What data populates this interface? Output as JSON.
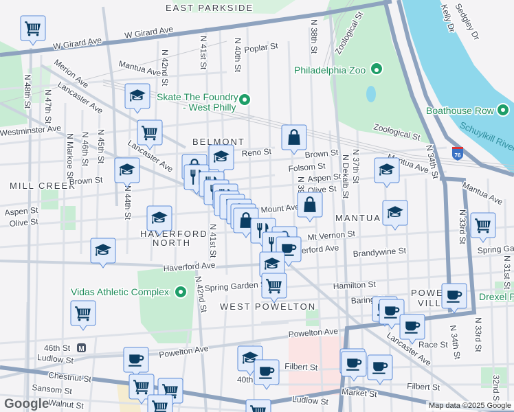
{
  "map": {
    "attribution": "Map data ©2025 Google",
    "logo": "Google",
    "colors": {
      "marker_fill": "#e3ecfb",
      "marker_border": "#5b8bd8",
      "marker_icon": "#0b3d62",
      "park": "#c8ecd4",
      "water": "#8fd8ec",
      "major_road": "#8ea3bf",
      "poi": "#1e8a5a"
    },
    "neighborhoods": [
      "EAST PARKSIDE",
      "BELMONT",
      "MILL CREEK",
      "HAVERFORD",
      "NORTH",
      "MANTUA",
      "WEST POWELTON",
      "POWEL",
      "VILLA"
    ],
    "pois": [
      "Philadelphia Zoo",
      "Skate The Foundry",
      "- West Philly",
      "Boathouse Row",
      "Vidas Athletic Complex",
      "Drexel P"
    ],
    "water": [
      "Schuylkill River"
    ],
    "highway_shield": "76",
    "streets": [
      "W Girard Ave",
      "W Girard Ave",
      "Mantua Ave",
      "Merion Ave",
      "Lancaster Ave",
      "Lancaster Ave",
      "N 48th St",
      "N 47th St",
      "N 42nd St",
      "N 41st St",
      "N 40th St",
      "N 38th St",
      "Poplar St",
      "Zoological St",
      "Zoological St",
      "Westminster Ave",
      "N Markoe St",
      "N 46th St",
      "N 45th St",
      "Reno St",
      "Brown St",
      "Brown St",
      "Folsom St",
      "Aspen St",
      "Olive St",
      "N 37th St",
      "N Dekalb St",
      "Mantua Ave",
      "Mantua Ave",
      "N 34th St",
      "N 44th St",
      "Aspen St",
      "Olive St",
      "N 41st St",
      "Mt Vernon St",
      "Haverford Ave",
      "Haverford Ave",
      "Brandywine St",
      "N 33rd St",
      "Spring Gar",
      "N 31st St",
      "Spring Garden St",
      "N 42nd St",
      "Hamilton St",
      "Baring St",
      "Powelton Ave",
      "Powelton Ave",
      "46th St",
      "Race St",
      "Lancaster Ave",
      "N 34th St",
      "N 33rd St",
      "32nd St",
      "Ludlow St",
      "Chestnut St",
      "Sansom St",
      "Walnut St",
      "40th St",
      "Filbert St",
      "Filbert St",
      "Market St",
      "Ludlow St",
      "Kelly Dr",
      "Sedgley Dr",
      "N 39th St",
      "Mount Ave"
    ],
    "markers": [
      "grocery",
      "school",
      "grocery",
      "school",
      "shopping",
      "school",
      "shopping",
      "restaurant",
      "restaurant",
      "restaurant",
      "restaurant",
      "restaurant",
      "restaurant",
      "shopping",
      "shopping",
      "shopping",
      "restaurant",
      "shopping",
      "restaurant",
      "cafe",
      "school",
      "grocery",
      "school",
      "shopping",
      "school",
      "school",
      "school",
      "grocery",
      "grocery",
      "cafe",
      "cafe",
      "cafe",
      "cafe",
      "cafe",
      "school",
      "cafe",
      "cafe",
      "cafe",
      "cafe",
      "grocery",
      "grocery",
      "grocery",
      "grocery"
    ]
  }
}
